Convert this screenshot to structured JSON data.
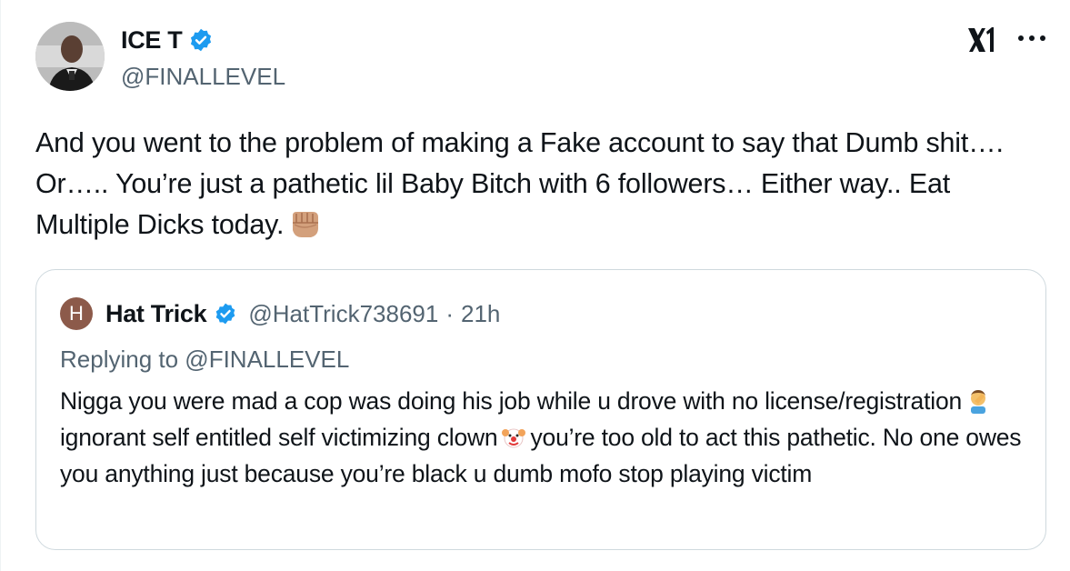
{
  "author": {
    "display_name": "ICE T",
    "handle": "@FINALLEVEL",
    "verified": true
  },
  "tweet": {
    "text": "And you went to the problem of making a Fake account to say that Dumb shit…. Or….. You’re just a pathetic lil Baby Bitch with 6 followers… Either way.. Eat Multiple Dicks today.",
    "trailing_emoji": "fist-bump-medium-light-skin-emoji"
  },
  "quote": {
    "avatar_letter": "H",
    "display_name": "Hat Trick",
    "verified": true,
    "handle": "@HatTrick738691",
    "separator": "·",
    "time": "21h",
    "replying_to": "Replying to @FINALLEVEL",
    "text_part1": "Nigga you were mad a cop was doing his job while u drove with no license/registration",
    "text_part2": "ignorant self entitled self victimizing clown",
    "text_part3": "you’re too old to act this pathetic. No one owes you anything just because you’re black u dumb mofo stop playing victim",
    "emoji1": "man-facepalming-emoji",
    "emoji2": "clown-face-emoji"
  },
  "icons": {
    "verified": "verified-badge-icon",
    "platform": "x-logo-icon",
    "more": "more-options-icon"
  },
  "colors": {
    "verified_blue": "#1d9bf0",
    "text_primary": "#0f1419",
    "text_secondary": "#536471",
    "border": "#cfd9de",
    "quote_avatar": "#8c5a4a"
  }
}
